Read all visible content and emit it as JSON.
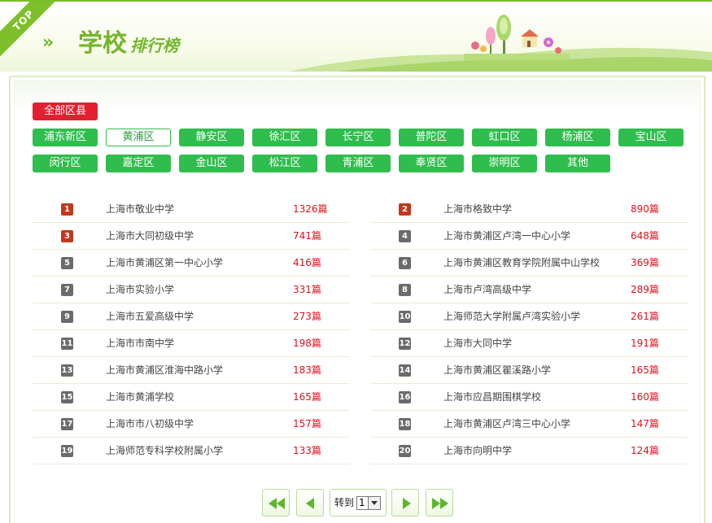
{
  "header": {
    "ribbon": "TOP",
    "title_big": "学校",
    "title_small": "排行榜",
    "accent": "#74b62b"
  },
  "filters": {
    "all_label": "全部区县",
    "selected": "黄浦区",
    "districts": [
      "浦东新区",
      "黄浦区",
      "静安区",
      "徐汇区",
      "长宁区",
      "普陀区",
      "虹口区",
      "杨浦区",
      "宝山区",
      "闵行区",
      "嘉定区",
      "金山区",
      "松江区",
      "青浦区",
      "奉贤区",
      "崇明区",
      "其他"
    ]
  },
  "rankings": [
    {
      "rank": "1",
      "school": "上海市敬业中学",
      "count": "1326篇"
    },
    {
      "rank": "2",
      "school": "上海市格致中学",
      "count": "890篇"
    },
    {
      "rank": "3",
      "school": "上海市大同初级中学",
      "count": "741篇"
    },
    {
      "rank": "4",
      "school": "上海市黄浦区卢湾一中心小学",
      "count": "648篇"
    },
    {
      "rank": "5",
      "school": "上海市黄浦区第一中心小学",
      "count": "416篇"
    },
    {
      "rank": "6",
      "school": "上海市黄浦区教育学院附属中山学校",
      "count": "369篇"
    },
    {
      "rank": "7",
      "school": "上海市实验小学",
      "count": "331篇"
    },
    {
      "rank": "8",
      "school": "上海市卢湾高级中学",
      "count": "289篇"
    },
    {
      "rank": "9",
      "school": "上海市五爱高级中学",
      "count": "273篇"
    },
    {
      "rank": "10",
      "school": "上海师范大学附属卢湾实验小学",
      "count": "261篇"
    },
    {
      "rank": "11",
      "school": "上海市市南中学",
      "count": "198篇"
    },
    {
      "rank": "12",
      "school": "上海市大同中学",
      "count": "191篇"
    },
    {
      "rank": "13",
      "school": "上海市黄浦区淮海中路小学",
      "count": "183篇"
    },
    {
      "rank": "14",
      "school": "上海市黄浦区瞿溪路小学",
      "count": "165篇"
    },
    {
      "rank": "15",
      "school": "上海市黄浦学校",
      "count": "165篇"
    },
    {
      "rank": "16",
      "school": "上海市应昌期围棋学校",
      "count": "160篇"
    },
    {
      "rank": "17",
      "school": "上海市市八初级中学",
      "count": "157篇"
    },
    {
      "rank": "18",
      "school": "上海市黄浦区卢湾三中心小学",
      "count": "147篇"
    },
    {
      "rank": "19",
      "school": "上海师范专科学校附属小学",
      "count": "133篇"
    },
    {
      "rank": "20",
      "school": "上海市向明中学",
      "count": "124篇"
    }
  ],
  "pagination": {
    "goto_label": "转到",
    "page_value": "1",
    "icons": [
      "first-page-icon",
      "prev-page-icon",
      "next-page-icon",
      "last-page-icon"
    ]
  },
  "colors": {
    "district_bg": "#2fbd4d",
    "all_bg": "#e2202f",
    "count": "#e0101b",
    "badge_hot": "#c2381d",
    "badge_normal": "#6b6b6b"
  }
}
